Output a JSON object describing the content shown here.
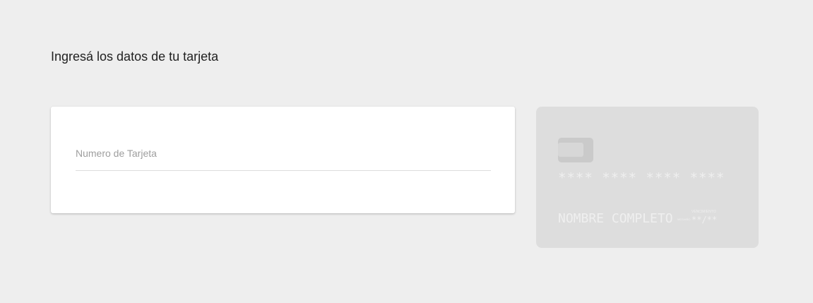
{
  "header": {
    "title": "Ingresá los datos de tu tarjeta"
  },
  "form": {
    "card_number_label": "Numero de Tarjeta",
    "card_number_value": ""
  },
  "card_preview": {
    "number": "**** **** **** ****",
    "holder_name": "NOMBRE COMPLETO",
    "valid_thru_label": "MES/AÑO",
    "expiry_caption": "VENCIMIENTO",
    "expiry": "**/**",
    "chip_icon": "card-chip-icon",
    "colors": {
      "card_background": "#dddddd",
      "chip": "#cacaca",
      "text": "#efefef"
    }
  }
}
